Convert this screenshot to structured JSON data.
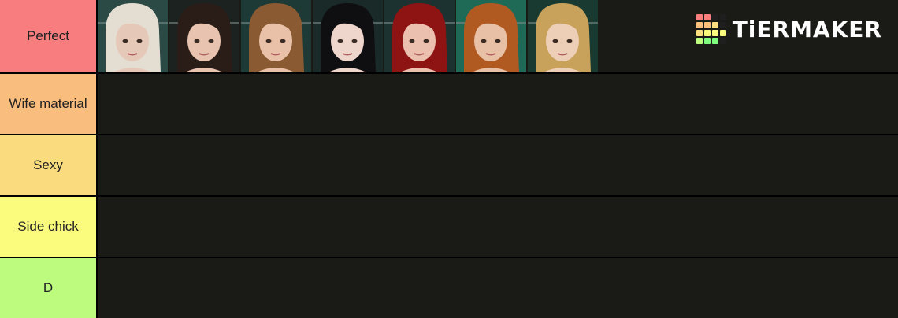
{
  "brand": {
    "name": "TiERMAKER",
    "grid_colors": [
      "#ff7f7f",
      "#ff7f7f",
      "#1f1f1f",
      "#1f1f1f",
      "#ffbf7f",
      "#ffbf7f",
      "#ffdf7f",
      "#1f1f1f",
      "#ffdf7f",
      "#ffff7f",
      "#ffff7f",
      "#ffff7f",
      "#bfff7f",
      "#7fff7f",
      "#7fff7f",
      "#1f1f1f"
    ]
  },
  "tiers": [
    {
      "label": "Perfect",
      "color": "#f87d7e"
    },
    {
      "label": "Wife material",
      "color": "#f9bd7e"
    },
    {
      "label": "Sexy",
      "color": "#fadb7e"
    },
    {
      "label": "Side chick",
      "color": "#fbfb7e"
    },
    {
      "label": "D",
      "color": "#bdfb7e"
    }
  ],
  "characters": [
    {
      "name": "platinum-blonde-character",
      "hair": "#e4ddd2",
      "bg": "#2c4a45",
      "skin": "#e6c8b8"
    },
    {
      "name": "dark-brown-hair-character",
      "hair": "#2a1d18",
      "bg": "#1c2220",
      "skin": "#e8c4b0"
    },
    {
      "name": "light-brown-hair-character",
      "hair": "#8a5a32",
      "bg": "#1e3a36",
      "skin": "#e9c0a8"
    },
    {
      "name": "black-hair-character",
      "hair": "#0f0f12",
      "bg": "#1a2a28",
      "skin": "#efd6cc"
    },
    {
      "name": "red-hair-character",
      "hair": "#8e1414",
      "bg": "#1c3230",
      "skin": "#ebc0ae"
    },
    {
      "name": "curly-auburn-hair-character",
      "hair": "#b05a22",
      "bg": "#1f6a56",
      "skin": "#e8c0a6"
    },
    {
      "name": "blonde-hair-character",
      "hair": "#c8a25a",
      "bg": "#183a30",
      "skin": "#edcfb8"
    }
  ]
}
